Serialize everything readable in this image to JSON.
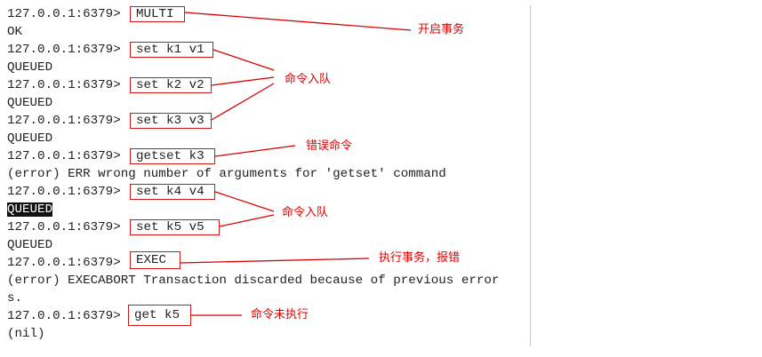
{
  "prompt": "127.0.0.1:6379>",
  "lines": {
    "r1_cmd": "MULTI",
    "r2": "OK",
    "r3_cmd": "set k1 v1",
    "r4": "QUEUED",
    "r5_cmd": "set k2 v2",
    "r6": "QUEUED",
    "r7_cmd": "set k3 v3",
    "r8": "QUEUED",
    "r9_cmd": "getset k3",
    "r10": "(error) ERR wrong number of arguments for 'getset' command",
    "r11_cmd": "set k4 v4",
    "r12": "QUEUED",
    "r13_cmd": "set k5 v5",
    "r14": "QUEUED",
    "r15_cmd": "EXEC",
    "r16": "(error) EXECABORT Transaction discarded because of previous error",
    "r17": "s.",
    "r18_cmd": "get k5",
    "r19": "(nil)"
  },
  "annotations": {
    "start_tx": "开启事务",
    "queue_1": "命令入队",
    "wrong_cmd": "错误命令",
    "queue_2": "命令入队",
    "exec_error": "执行事务，报错",
    "not_executed": "命令未执行"
  },
  "colors": {
    "annotation": "#e00000",
    "box_border": "#d01818",
    "text": "#222222",
    "highlight_bg": "#111111"
  }
}
